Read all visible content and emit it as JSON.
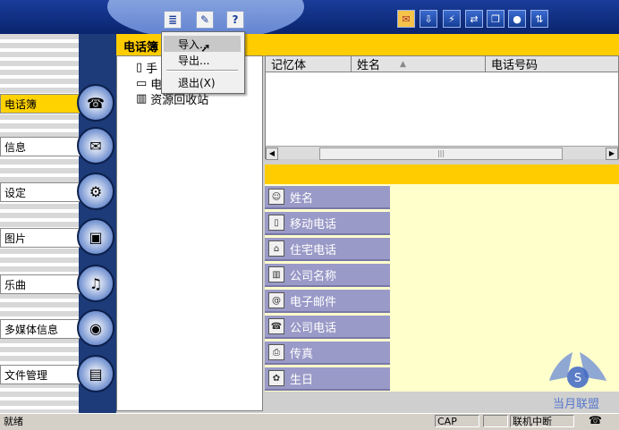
{
  "header": {
    "title": "电话簿"
  },
  "menu": {
    "items": [
      {
        "label": "导入..."
      },
      {
        "label": "导出..."
      },
      {
        "label": "退出(X)"
      }
    ]
  },
  "tree": {
    "items": [
      {
        "label": "手"
      },
      {
        "label": "电"
      },
      {
        "label": "资源回收站"
      }
    ]
  },
  "nav": {
    "items": [
      {
        "label": "电话簿",
        "icon": "phone-icon",
        "active": true
      },
      {
        "label": "信息",
        "icon": "envelope-icon"
      },
      {
        "label": "设定",
        "icon": "settings-icon"
      },
      {
        "label": "图片",
        "icon": "picture-icon"
      },
      {
        "label": "乐曲",
        "icon": "music-icon"
      },
      {
        "label": "多媒体信息",
        "icon": "balloon-icon"
      },
      {
        "label": "文件管理",
        "icon": "files-icon"
      }
    ]
  },
  "list": {
    "columns": [
      {
        "label": "记忆体"
      },
      {
        "label": "姓名"
      },
      {
        "label": "电话号码"
      }
    ],
    "scroll_mark": "|||"
  },
  "fields": [
    {
      "label": "姓名",
      "icon": "person-icon"
    },
    {
      "label": "移动电话",
      "icon": "mobile-icon"
    },
    {
      "label": "住宅电话",
      "icon": "home-phone-icon"
    },
    {
      "label": "公司名称",
      "icon": "company-icon"
    },
    {
      "label": "电子邮件",
      "icon": "email-icon"
    },
    {
      "label": "公司电话",
      "icon": "office-phone-icon"
    },
    {
      "label": "传真",
      "icon": "fax-icon"
    },
    {
      "label": "生日",
      "icon": "birthday-icon"
    }
  ],
  "status": {
    "ready": "就绪",
    "cap": "CAP",
    "connection": "联机中断"
  },
  "watermark": {
    "text": "当月联盟",
    "sub": "S"
  },
  "colors": {
    "accent_yellow": "#ffcc00",
    "nav_blue": "#1c3b78",
    "field_label": "#9a9ac8",
    "detail_bg": "#ffffcc"
  }
}
